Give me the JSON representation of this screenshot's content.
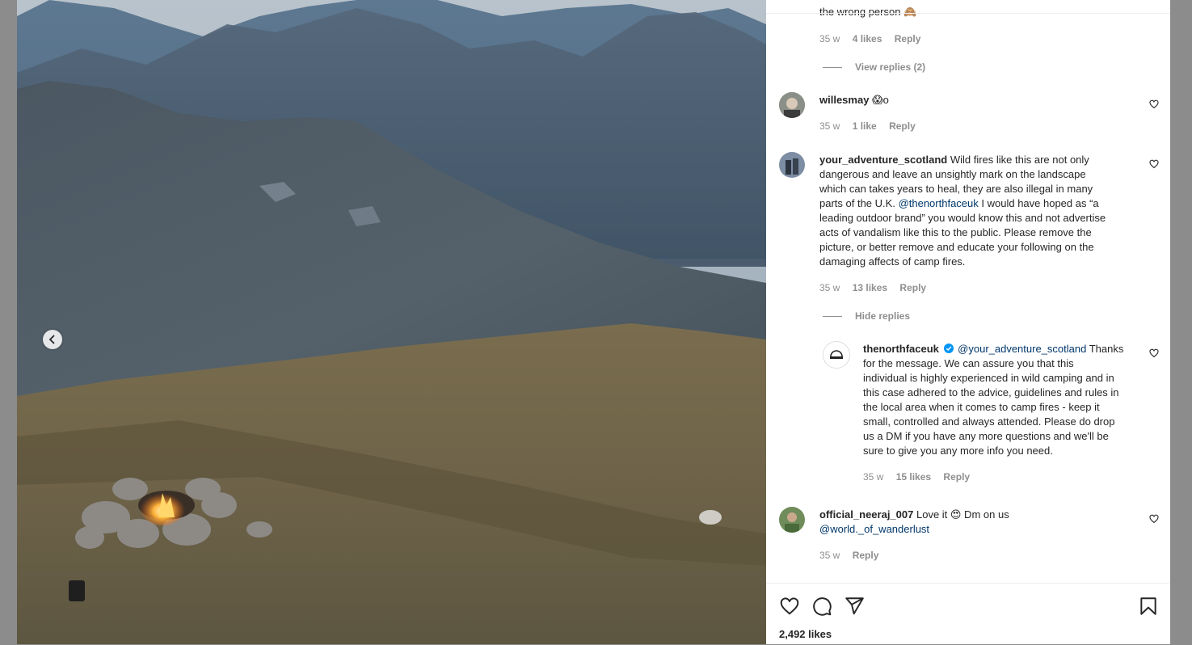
{
  "post": {
    "likes_text": "2,492 likes"
  },
  "comments_top": {
    "snippet": "the wrong person",
    "time": "35 w",
    "likes": "4 likes",
    "reply": "Reply",
    "view_replies": "View replies (2)"
  },
  "comments": [
    {
      "username": "willesmay",
      "text": "😱o",
      "time": "35 w",
      "likes": "1 like",
      "reply": "Reply"
    },
    {
      "username": "your_adventure_scotland",
      "text_lines": [
        "Wild fires like this are not only",
        "dangerous and leave an unsightly mark on the landscape",
        "which can takes years to heal, they are also illegal in many",
        "parts of the U.K.",
        "I would have hoped as “a",
        "leading outdoor brand” you would know this and not advertise",
        "acts of vandalism like this to the public. Please remove the",
        "picture, or better remove and educate your following on the",
        "damaging affects of camp fires."
      ],
      "mention": "@thenorthfaceuk",
      "time": "35 w",
      "likes": "13 likes",
      "reply": "Reply",
      "hide_replies": "Hide replies"
    },
    {
      "username": "official_neeraj_007",
      "text": "Love it 😍 Dm on us",
      "mention": "@world._of_wanderlust",
      "time": "35 w",
      "reply": "Reply"
    }
  ],
  "reply": {
    "username": "thenorthfaceuk",
    "mention": "@your_adventure_scotland",
    "text_lines": [
      "Thanks",
      "for the message. We can assure you that this",
      "individual is highly experienced in wild camping and in",
      "this case adhered to the advice, guidelines and rules in",
      "the local area when it comes to camp fires - keep it",
      "small, controlled and always attended. Please do drop",
      "us a DM if you have any more questions and we'll be",
      "sure to give you any more info you need."
    ],
    "time": "35 w",
    "likes": "15 likes",
    "reply": "Reply"
  },
  "icons": {
    "like": "heart-icon",
    "comment": "comment-bubble-icon",
    "share": "paper-plane-icon",
    "save": "bookmark-icon",
    "prev": "chevron-left-icon"
  },
  "colors": {
    "link": "#00376b",
    "meta": "#8e8e8e",
    "verified": "#0095f6"
  }
}
